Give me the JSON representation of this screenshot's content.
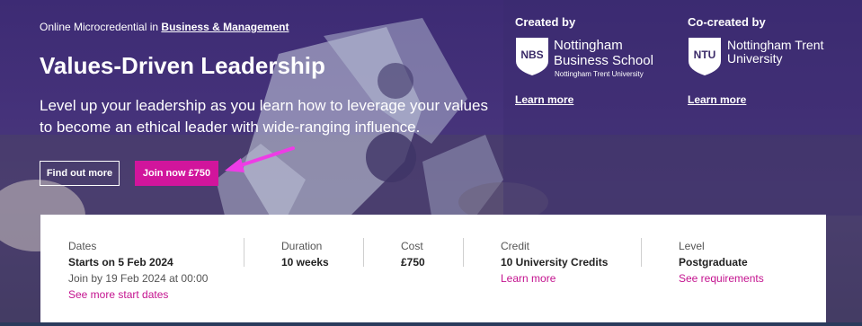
{
  "header": {
    "eyebrow_prefix": "Online Microcredential in",
    "eyebrow_link": "Business & Management",
    "title": "Values-Driven Leadership",
    "description": "Level up your leadership as you learn how to leverage your values to become an ethical leader with wide-ranging influence."
  },
  "actions": {
    "find_out_more": "Find out more",
    "join_now": "Join now £750"
  },
  "partners": {
    "created_by": {
      "heading": "Created by",
      "logo_abbr": "NBS",
      "name_line1": "Nottingham",
      "name_line2": "Business School",
      "sub": "Nottingham Trent University",
      "link": "Learn more"
    },
    "co_created_by": {
      "heading": "Co-created by",
      "logo_abbr": "NTU",
      "name_line1": "Nottingham Trent",
      "name_line2": "University",
      "link": "Learn more"
    }
  },
  "details": {
    "dates": {
      "label": "Dates",
      "value": "Starts on 5 Feb 2024",
      "extra": "Join by 19 Feb 2024 at 00:00",
      "link": "See more start dates"
    },
    "duration": {
      "label": "Duration",
      "value": "10 weeks"
    },
    "cost": {
      "label": "Cost",
      "value": "£750"
    },
    "credit": {
      "label": "Credit",
      "value": "10 University Credits",
      "link": "Learn more"
    },
    "level": {
      "label": "Level",
      "value": "Postgraduate",
      "link": "See requirements"
    }
  },
  "colors": {
    "hero_bg": "#3d2b74",
    "accent_pink": "#d1159c",
    "link_pink": "#c4138f",
    "arrow_magenta": "#ee3ce6"
  }
}
